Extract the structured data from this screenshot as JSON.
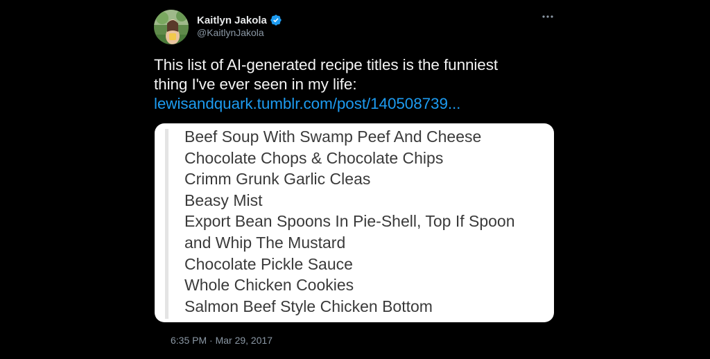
{
  "author": {
    "display_name": "Kaitlyn Jakola",
    "handle": "@KaitlynJakola",
    "verified": true,
    "avatar_icon": "profile-photo"
  },
  "tweet": {
    "text_line1": "This list of AI-generated recipe titles is the funniest",
    "text_line2": "thing I've ever seen in my life:",
    "link_text": "lewisandquark.tumblr.com/post/140508739...",
    "timestamp": "6:35 PM · Mar 29, 2017"
  },
  "media": {
    "recipe_titles": [
      "Beef Soup With Swamp Peef And Cheese",
      "Chocolate Chops & Chocolate Chips",
      "Crimm Grunk Garlic Cleas",
      "Beasy Mist",
      "Export Bean Spoons In Pie-Shell, Top If Spoon",
      "and Whip The Mustard",
      "Chocolate Pickle Sauce",
      "Whole Chicken Cookies",
      "Salmon Beef Style Chicken Bottom"
    ]
  },
  "icons": {
    "more": "more-horizontal-icon",
    "verified": "verified-badge-icon"
  },
  "colors": {
    "background": "#000000",
    "link": "#1d9bf0",
    "verified": "#1d9bf0",
    "secondary_text": "#8b98a5",
    "card": "#ffffff"
  }
}
